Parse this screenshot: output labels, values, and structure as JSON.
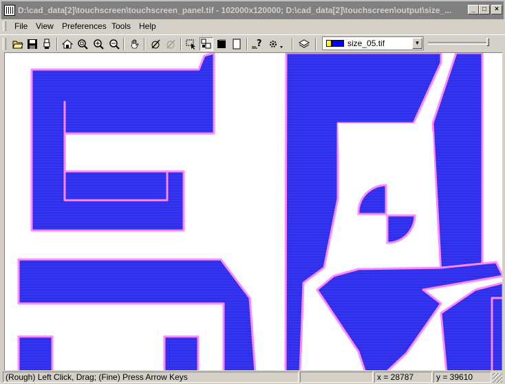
{
  "window": {
    "title": "D:\\cad_data[2]\\touchscreen\\touchscreen_panel.tif - 102000x120000; D:\\cad_data[2]\\touchscreen\\output\\size_...",
    "minimize": "_",
    "maximize": "□",
    "close": "×"
  },
  "menu": {
    "items": [
      "File",
      "View",
      "Preferences",
      "Tools",
      "Help"
    ]
  },
  "toolbar": {
    "layer_select": {
      "value": "size_05.tif",
      "swatch_colors": [
        "#ffff00",
        "#0000ff"
      ]
    },
    "icons": [
      "open-folder-icon",
      "save-icon",
      "printer-icon",
      "home-icon",
      "zoom-window-icon",
      "zoom-in-icon",
      "zoom-out-icon",
      "pan-hand-icon",
      "measure-icon",
      "measure-disabled-icon",
      "select-arrow-icon",
      "select-region-icon",
      "fill-black-icon",
      "fill-white-icon",
      "help-pointer-icon",
      "settings-icon",
      "layers-icon"
    ]
  },
  "colors": {
    "fill": "#3333ee",
    "outline": "#ff88ff",
    "background": "#ffffff"
  },
  "status": {
    "hint": "(Rough) Left Click, Drag; (Fine) Press Arrow Keys",
    "x": "x = 28787",
    "y": "y = 39610"
  }
}
